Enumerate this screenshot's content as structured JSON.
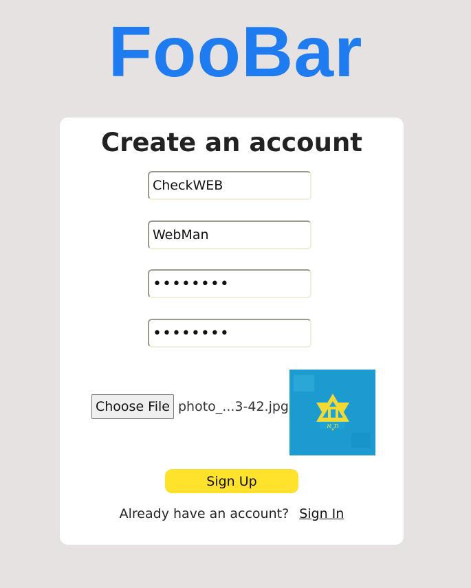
{
  "brand": {
    "title": "FooBar",
    "color": "#1e7bf0"
  },
  "form": {
    "title": "Create an account",
    "username_value": "CheckWEB",
    "displayname_value": "WebMan",
    "password_value": "password",
    "confirm_password_value": "password",
    "file_button_label": "Choose File",
    "file_name": "photo_...3-42.jpg",
    "profile_preview_icon": "star-of-david-logo",
    "signup_label": "Sign Up",
    "signup_color": "#ffe22c",
    "footer_text": "Already have an account?",
    "signin_label": "Sign In"
  }
}
